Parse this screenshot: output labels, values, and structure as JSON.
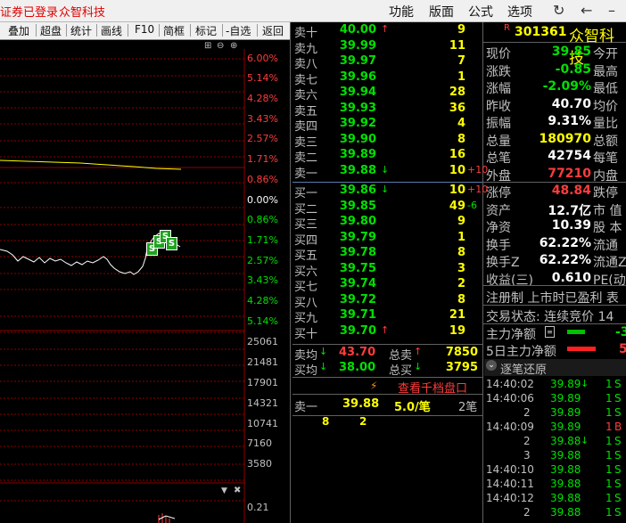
{
  "menubar": {
    "status": "证券已登录",
    "stock_name": "众智科技",
    "items": [
      "功能",
      "版面",
      "公式",
      "选项"
    ]
  },
  "toolbar": {
    "items": [
      "叠加",
      "超盘",
      "统计",
      "画线",
      "F10",
      "简框",
      "标记",
      "-自选",
      "返回"
    ]
  },
  "chart": {
    "upper_pct_labels": [
      "6.00%",
      "5.14%",
      "4.28%",
      "3.43%",
      "2.57%",
      "1.71%",
      "0.86%"
    ],
    "zero_label": "0.00%",
    "lower_pct_labels": [
      "0.86%",
      "1.71%",
      "2.57%",
      "3.43%",
      "4.28%",
      "5.14%"
    ],
    "volume_labels": [
      "25061",
      "21481",
      "17901",
      "14321",
      "10741",
      "7160",
      "3580"
    ],
    "indicator_label": "0.21",
    "markers": [
      "S",
      "S",
      "S",
      "S"
    ]
  },
  "order_book": {
    "asks": [
      {
        "name": "卖十",
        "price": "40.00",
        "arrow": "up",
        "vol": "9",
        "chg": ""
      },
      {
        "name": "卖九",
        "price": "39.99",
        "arrow": "",
        "vol": "11",
        "chg": ""
      },
      {
        "name": "卖八",
        "price": "39.97",
        "arrow": "",
        "vol": "7",
        "chg": ""
      },
      {
        "name": "卖七",
        "price": "39.96",
        "arrow": "",
        "vol": "1",
        "chg": ""
      },
      {
        "name": "卖六",
        "price": "39.94",
        "arrow": "",
        "vol": "28",
        "chg": ""
      },
      {
        "name": "卖五",
        "price": "39.93",
        "arrow": "",
        "vol": "36",
        "chg": ""
      },
      {
        "name": "卖四",
        "price": "39.92",
        "arrow": "",
        "vol": "4",
        "chg": ""
      },
      {
        "name": "卖三",
        "price": "39.90",
        "arrow": "",
        "vol": "8",
        "chg": ""
      },
      {
        "name": "卖二",
        "price": "39.89",
        "arrow": "",
        "vol": "16",
        "chg": ""
      },
      {
        "name": "卖一",
        "price": "39.88",
        "arrow": "down",
        "vol": "10",
        "chg": "+10"
      }
    ],
    "bids": [
      {
        "name": "买一",
        "price": "39.86",
        "arrow": "down",
        "vol": "10",
        "chg": "+10"
      },
      {
        "name": "买二",
        "price": "39.85",
        "arrow": "",
        "vol": "49",
        "chg": "-6"
      },
      {
        "name": "买三",
        "price": "39.80",
        "arrow": "",
        "vol": "9",
        "chg": ""
      },
      {
        "name": "买四",
        "price": "39.79",
        "arrow": "",
        "vol": "1",
        "chg": ""
      },
      {
        "name": "买五",
        "price": "39.78",
        "arrow": "",
        "vol": "8",
        "chg": ""
      },
      {
        "name": "买六",
        "price": "39.75",
        "arrow": "",
        "vol": "3",
        "chg": ""
      },
      {
        "name": "买七",
        "price": "39.74",
        "arrow": "",
        "vol": "2",
        "chg": ""
      },
      {
        "name": "买八",
        "price": "39.72",
        "arrow": "",
        "vol": "8",
        "chg": ""
      },
      {
        "name": "买九",
        "price": "39.71",
        "arrow": "",
        "vol": "21",
        "chg": ""
      },
      {
        "name": "买十",
        "price": "39.70",
        "arrow": "up",
        "vol": "19",
        "chg": ""
      }
    ],
    "avg_sell_label": "卖均",
    "avg_sell": "43.70",
    "total_sell_label": "总卖",
    "total_sell": "7850",
    "avg_buy_label": "买均",
    "avg_buy": "38.00",
    "total_buy_label": "总买",
    "total_buy": "3795",
    "view_thousand": "查看千档盘口",
    "sell1_label": "卖一",
    "sell1_price": "39.88",
    "sell1_qty": "5.0/笔",
    "sell1_count": "2笔",
    "queue": [
      "8",
      "2"
    ]
  },
  "info": {
    "code": "301361",
    "name": "众智科技",
    "rows": [
      {
        "label": "现价",
        "value": "39.85",
        "color": "green",
        "right": "今开"
      },
      {
        "label": "涨跌",
        "value": "-0.85",
        "color": "green",
        "right": "最高"
      },
      {
        "label": "涨幅",
        "value": "-2.09%",
        "color": "green",
        "right": "最低"
      },
      {
        "label": "昨收",
        "value": "40.70",
        "color": "white",
        "right": "均价"
      },
      {
        "label": "振幅",
        "value": "9.31%",
        "color": "white",
        "right": "量比"
      },
      {
        "label": "总量",
        "value": "180970",
        "color": "yellow",
        "right": "总额"
      },
      {
        "label": "总笔",
        "value": "42754",
        "color": "white",
        "right": "每笔"
      },
      {
        "label": "外盘",
        "value": "77210",
        "color": "red",
        "right": "内盘"
      }
    ],
    "rows2": [
      {
        "label": "涨停",
        "value": "48.84",
        "color": "red",
        "right": "跌停"
      },
      {
        "label": "资产",
        "value": "12.7亿",
        "color": "white",
        "right": "市 值"
      },
      {
        "label": "净资",
        "value": "10.39",
        "color": "white",
        "right": "股 本"
      },
      {
        "label": "换手",
        "value": "62.22%",
        "color": "white",
        "right": "流通"
      },
      {
        "label": "换手Z",
        "value": "62.22%",
        "color": "white",
        "right": "流通Z"
      },
      {
        "label": "收益(三)",
        "value": "0.610",
        "color": "white",
        "right": "PE(动"
      }
    ],
    "flags": "注册制 上市时已盈利 表",
    "trade_status": "交易状态: 连续竞价 14",
    "main_net_label": "主力净额",
    "main_net_value": "-3",
    "main5_label": "5日主力净额",
    "main5_value": "5",
    "tick_tab": "逐笔还原"
  },
  "ticks": [
    {
      "time": "14:40:02",
      "price": "39.89",
      "arrow": "down",
      "vol": "1",
      "bs": "S"
    },
    {
      "time": "14:40:06",
      "price": "39.89",
      "arrow": "",
      "vol": "1",
      "bs": "S"
    },
    {
      "time": "2",
      "price": "39.89",
      "arrow": "",
      "vol": "1",
      "bs": "S"
    },
    {
      "time": "14:40:09",
      "price": "39.89",
      "arrow": "",
      "vol": "1",
      "bs": "B"
    },
    {
      "time": "2",
      "price": "39.88",
      "arrow": "down",
      "vol": "1",
      "bs": "S"
    },
    {
      "time": "3",
      "price": "39.88",
      "arrow": "",
      "vol": "1",
      "bs": "S"
    },
    {
      "time": "14:40:10",
      "price": "39.88",
      "arrow": "",
      "vol": "1",
      "bs": "S"
    },
    {
      "time": "14:40:11",
      "price": "39.88",
      "arrow": "",
      "vol": "1",
      "bs": "S"
    },
    {
      "time": "14:40:12",
      "price": "39.88",
      "arrow": "",
      "vol": "1",
      "bs": "S"
    },
    {
      "time": "2",
      "price": "39.88",
      "arrow": "",
      "vol": "1",
      "bs": "S"
    }
  ],
  "colors": {
    "up": "#ff3c3c",
    "down": "#00e000",
    "accent": "#ffff00"
  }
}
